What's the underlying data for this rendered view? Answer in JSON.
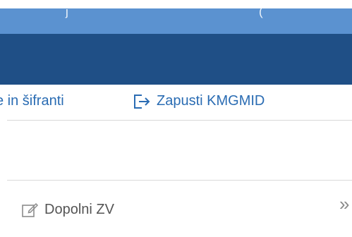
{
  "window": {
    "title_fragment_left": "j",
    "title_fragment_right": "(",
    "title_bar_color": "#5b92d0",
    "nav_band_color": "#1f4f86"
  },
  "menu": {
    "item_clipped_label": "e in šifranti",
    "exit_label": "Zapusti KMGMID",
    "exit_icon": "sign-out-icon",
    "accent_color": "#2a6cb3"
  },
  "actions": {
    "dopolni_label": "Dopolni ZV",
    "dopolni_icon": "edit-icon",
    "expand_icon": "double-chevron-right-icon",
    "expand_glyph": "»"
  }
}
